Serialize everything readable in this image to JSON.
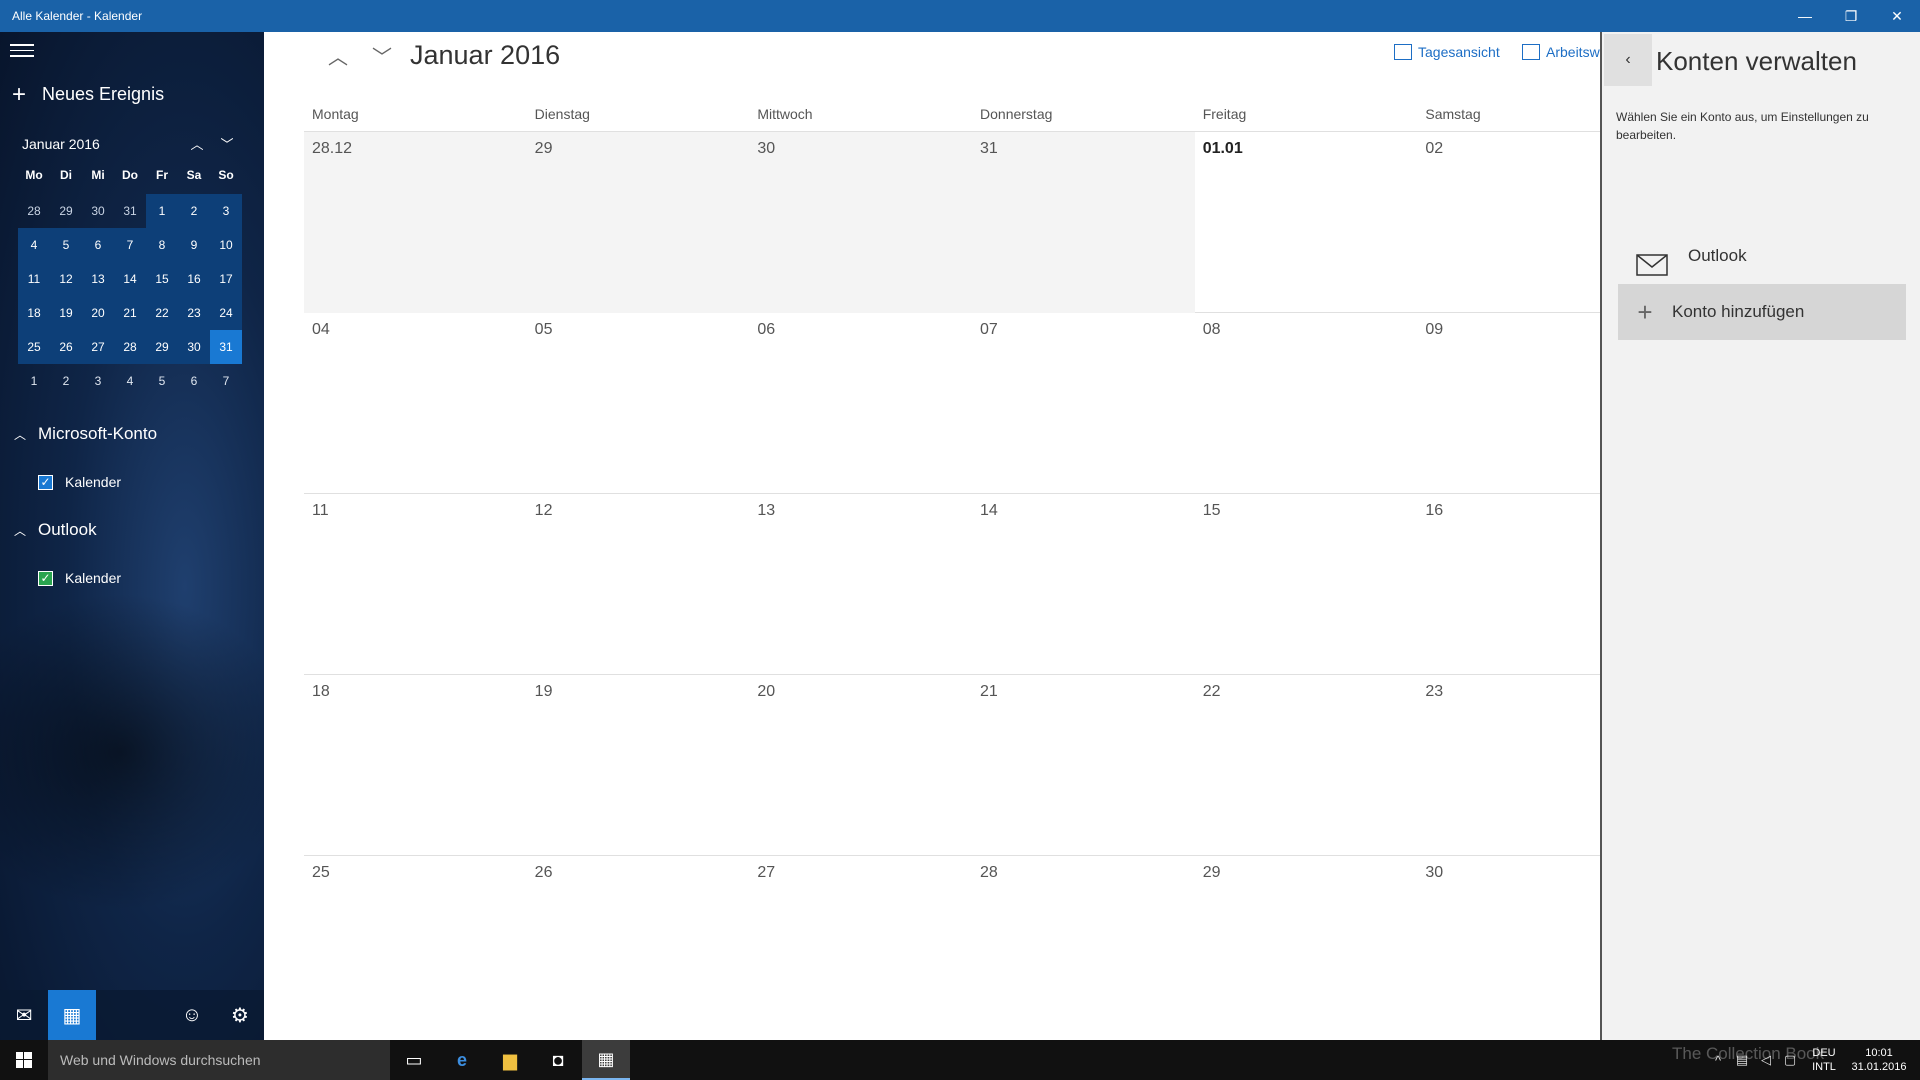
{
  "window": {
    "title": "Alle Kalender - Kalender"
  },
  "sidebar": {
    "new_event_label": "Neues Ereignis",
    "mini_calendar": {
      "month_label": "Januar 2016",
      "weekday_headers": [
        "Mo",
        "Di",
        "Mi",
        "Do",
        "Fr",
        "Sa",
        "So"
      ],
      "weeks": [
        [
          "28",
          "29",
          "30",
          "31",
          "1",
          "2",
          "3"
        ],
        [
          "4",
          "5",
          "6",
          "7",
          "8",
          "9",
          "10"
        ],
        [
          "11",
          "12",
          "13",
          "14",
          "15",
          "16",
          "17"
        ],
        [
          "18",
          "19",
          "20",
          "21",
          "22",
          "23",
          "24"
        ],
        [
          "25",
          "26",
          "27",
          "28",
          "29",
          "30",
          "31"
        ],
        [
          "1",
          "2",
          "3",
          "4",
          "5",
          "6",
          "7"
        ]
      ],
      "selected_day": "31"
    },
    "groups": [
      {
        "name": "Microsoft-Konto",
        "calendars": [
          {
            "label": "Kalender",
            "checked": true,
            "color": "#1979d3"
          }
        ]
      },
      {
        "name": "Outlook",
        "calendars": [
          {
            "label": "Kalender",
            "checked": true,
            "color": "#2aa44f"
          }
        ]
      }
    ]
  },
  "main": {
    "month_title": "Januar 2016",
    "views": [
      {
        "label": "Tagesansicht",
        "icon": "calendar-day-icon"
      },
      {
        "label": "Arbeitsw",
        "icon": "calendar-workweek-icon"
      }
    ],
    "weekday_headers": [
      "Montag",
      "Dienstag",
      "Mittwoch",
      "Donnerstag",
      "Freitag",
      "Samstag"
    ],
    "weeks": [
      [
        "28.12",
        "29",
        "30",
        "31",
        "01.01",
        "02"
      ],
      [
        "04",
        "05",
        "06",
        "07",
        "08",
        "09"
      ],
      [
        "11",
        "12",
        "13",
        "14",
        "15",
        "16"
      ],
      [
        "18",
        "19",
        "20",
        "21",
        "22",
        "23"
      ],
      [
        "25",
        "26",
        "27",
        "28",
        "29",
        "30"
      ]
    ]
  },
  "pane": {
    "title": "Konten verwalten",
    "description": "Wählen Sie ein Konto aus, um Einstellungen zu bearbeiten.",
    "accounts": [
      {
        "label": "Outlook",
        "icon": "mail-icon"
      }
    ],
    "add_account_label": "Konto hinzufügen"
  },
  "taskbar": {
    "search_placeholder": "Web und Windows durchsuchen",
    "language": [
      "DEU",
      "INTL"
    ],
    "time": "10:01",
    "date": "31.01.2016",
    "watermark": "The Collection Book"
  },
  "colors": {
    "accent": "#1979d3",
    "titlebar": "#1a62a8",
    "sidebar_dark": "#0f2547"
  }
}
